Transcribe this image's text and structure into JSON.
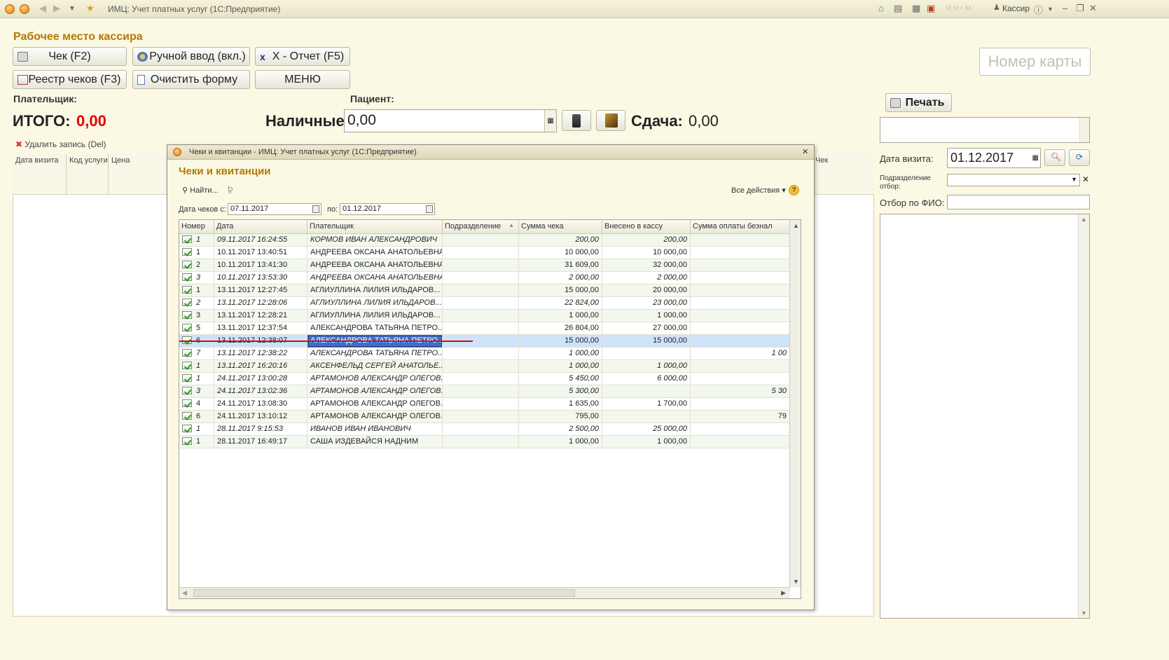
{
  "window": {
    "title": "ИМЦ: Учет платных услуг  (1С:Предприятие)",
    "user": "Кассир"
  },
  "page_title": "Рабочее место кассира",
  "buttons": {
    "check": "Чек (F2)",
    "manual": "Ручной ввод (вкл.)",
    "xreport": "X - Отчет (F5)",
    "registry": "Реестр чеков (F3)",
    "clear": "Очистить форму",
    "menu": "МЕНЮ"
  },
  "labels": {
    "payer": "Плательщик:",
    "patient": "Пациент:",
    "total_label": "ИТОГО:",
    "total_value": "0,00",
    "cash_label": "Наличные:",
    "cash_value": "0,00",
    "change_label": "Сдача:",
    "change_value": "0,00",
    "delete_row": "Удалить запись (Del)"
  },
  "main_grid": {
    "columns": [
      "Дата визита",
      "Код услуги",
      "Цена"
    ],
    "hidden_col": "Чек"
  },
  "right_panel": {
    "card_placeholder": "Номер карты",
    "print": "Печать",
    "visit_date_label": "Дата визита:",
    "visit_date": "01.12.2017",
    "dept_label_1": "Подразделение",
    "dept_label_2": "отбор:",
    "fio_label": "Отбор по ФИО:"
  },
  "modal": {
    "title": "Чеки и квитанции - ИМЦ: Учет платных услуг  (1С:Предприятие)",
    "heading": "Чеки и квитанции",
    "find": "Найти...",
    "all_actions": "Все действия",
    "date_from_label": "Дата чеков с:",
    "date_from": "07.11.2017",
    "date_to_label": "по:",
    "date_to": "01.12.2017",
    "columns": [
      "Номер",
      "Дата",
      "Плательщик",
      "Подразделение",
      "Сумма чека",
      "Внесено в кассу",
      "Сумма оплаты безнал"
    ],
    "rows": [
      {
        "num": "1",
        "date": "09.11.2017 16:24:55",
        "payer": "КОРМОВ ИВАН АЛЕКСАНДРОВИЧ",
        "dept": "",
        "sum": "200,00",
        "paid": "200,00",
        "card": "",
        "italic": true
      },
      {
        "num": "1",
        "date": "10.11.2017 13:40:51",
        "payer": "АНДРЕЕВА ОКСАНА АНАТОЛЬЕВНА",
        "dept": "",
        "sum": "10 000,00",
        "paid": "10 000,00",
        "card": "",
        "italic": false
      },
      {
        "num": "2",
        "date": "10.11.2017 13:41:30",
        "payer": "АНДРЕЕВА ОКСАНА АНАТОЛЬЕВНА",
        "dept": "",
        "sum": "31 609,00",
        "paid": "32 000,00",
        "card": "",
        "italic": false
      },
      {
        "num": "3",
        "date": "10.11.2017 13:53:30",
        "payer": "АНДРЕЕВА ОКСАНА АНАТОЛЬЕВНА",
        "dept": "",
        "sum": "2 000,00",
        "paid": "2 000,00",
        "card": "",
        "italic": true
      },
      {
        "num": "1",
        "date": "13.11.2017 12:27:45",
        "payer": "АГЛИУЛЛИНА ЛИЛИЯ ИЛЬДАРОВ...",
        "dept": "",
        "sum": "15 000,00",
        "paid": "20 000,00",
        "card": "",
        "italic": false
      },
      {
        "num": "2",
        "date": "13.11.2017 12:28:06",
        "payer": "АГЛИУЛЛИНА ЛИЛИЯ ИЛЬДАРОВ...",
        "dept": "",
        "sum": "22 824,00",
        "paid": "23 000,00",
        "card": "",
        "italic": true
      },
      {
        "num": "3",
        "date": "13.11.2017 12:28:21",
        "payer": "АГЛИУЛЛИНА ЛИЛИЯ ИЛЬДАРОВ...",
        "dept": "",
        "sum": "1 000,00",
        "paid": "1 000,00",
        "card": "",
        "italic": false
      },
      {
        "num": "5",
        "date": "13.11.2017 12:37:54",
        "payer": "АЛЕКСАНДРОВА ТАТЬЯНА ПЕТРО...",
        "dept": "",
        "sum": "26 804,00",
        "paid": "27 000,00",
        "card": "",
        "italic": false
      },
      {
        "num": "6",
        "date": "13.11.2017 12:38:07",
        "payer": "АЛЕКСАНДРОВА ТАТЬЯНА ПЕТРО...",
        "dept": "",
        "sum": "15 000,00",
        "paid": "15 000,00",
        "card": "",
        "italic": false,
        "selected": true
      },
      {
        "num": "7",
        "date": "13.11.2017 12:38:22",
        "payer": "АЛЕКСАНДРОВА ТАТЬЯНА ПЕТРО...",
        "dept": "",
        "sum": "1 000,00",
        "paid": "",
        "card": "1 00",
        "italic": true
      },
      {
        "num": "1",
        "date": "13.11.2017 16:20:16",
        "payer": "АКСЕНФЕЛЬД СЕРГЕЙ АНАТОЛЬЕ...",
        "dept": "",
        "sum": "1 000,00",
        "paid": "1 000,00",
        "card": "",
        "italic": true
      },
      {
        "num": "1",
        "date": "24.11.2017 13:00:28",
        "payer": "АРТАМОНОВ АЛЕКСАНДР ОЛЕГОВ...",
        "dept": "",
        "sum": "5 450,00",
        "paid": "6 000,00",
        "card": "",
        "italic": true
      },
      {
        "num": "3",
        "date": "24.11.2017 13:02:36",
        "payer": "АРТАМОНОВ АЛЕКСАНДР ОЛЕГОВ...",
        "dept": "",
        "sum": "5 300,00",
        "paid": "",
        "card": "5 30",
        "italic": true
      },
      {
        "num": "4",
        "date": "24.11.2017 13:08:30",
        "payer": "АРТАМОНОВ АЛЕКСАНДР ОЛЕГОВ...",
        "dept": "",
        "sum": "1 635,00",
        "paid": "1 700,00",
        "card": "",
        "italic": false
      },
      {
        "num": "6",
        "date": "24.11.2017 13:10:12",
        "payer": "АРТАМОНОВ АЛЕКСАНДР ОЛЕГОВ...",
        "dept": "",
        "sum": "795,00",
        "paid": "",
        "card": "79",
        "italic": false
      },
      {
        "num": "1",
        "date": "28.11.2017 9:15:53",
        "payer": "ИВАНОВ ИВАН ИВАНОВИЧ",
        "dept": "",
        "sum": "2 500,00",
        "paid": "25 000,00",
        "card": "",
        "italic": true
      },
      {
        "num": "1",
        "date": "28.11.2017 16:49:17",
        "payer": "САША ИЗДЕВАЙСЯ НАДНИМ",
        "dept": "",
        "sum": "1 000,00",
        "paid": "1 000,00",
        "card": "",
        "italic": false
      }
    ]
  },
  "colors": {
    "title_gold": "#b07a00",
    "total_red": "#e00000",
    "selection": "#cfe3f8",
    "underline_red": "#cc1111"
  }
}
